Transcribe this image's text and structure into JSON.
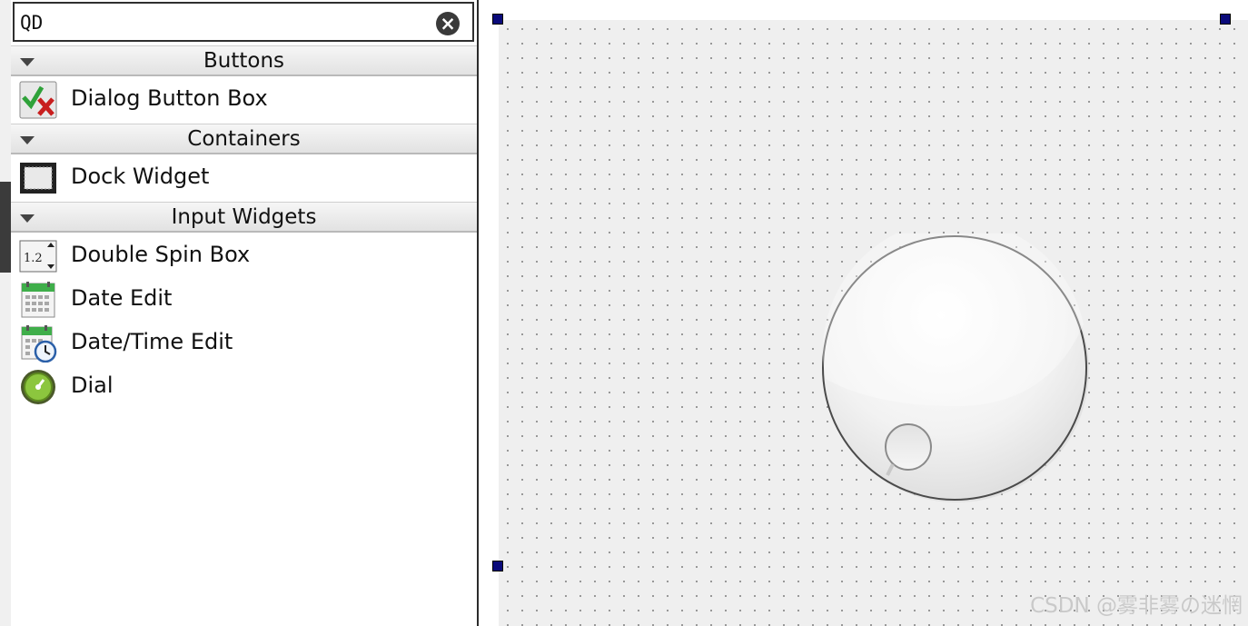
{
  "search": {
    "value": "QD",
    "clear_icon": "clear-icon"
  },
  "categories": [
    {
      "label": "Buttons",
      "items": [
        {
          "label": "Dialog Button Box",
          "icon": "dialog-button-box-icon"
        }
      ]
    },
    {
      "label": "Containers",
      "items": [
        {
          "label": "Dock Widget",
          "icon": "dock-widget-icon"
        }
      ]
    },
    {
      "label": "Input Widgets",
      "items": [
        {
          "label": "Double Spin Box",
          "icon": "double-spin-box-icon"
        },
        {
          "label": "Date Edit",
          "icon": "date-edit-icon"
        },
        {
          "label": "Date/Time Edit",
          "icon": "date-time-edit-icon"
        },
        {
          "label": "Dial",
          "icon": "dial-icon"
        }
      ]
    }
  ],
  "watermark": "CSDN @雾非雾の迷惘",
  "colors": {
    "selection_handle": "#0a0a7a",
    "canvas_bg": "#efefef"
  }
}
